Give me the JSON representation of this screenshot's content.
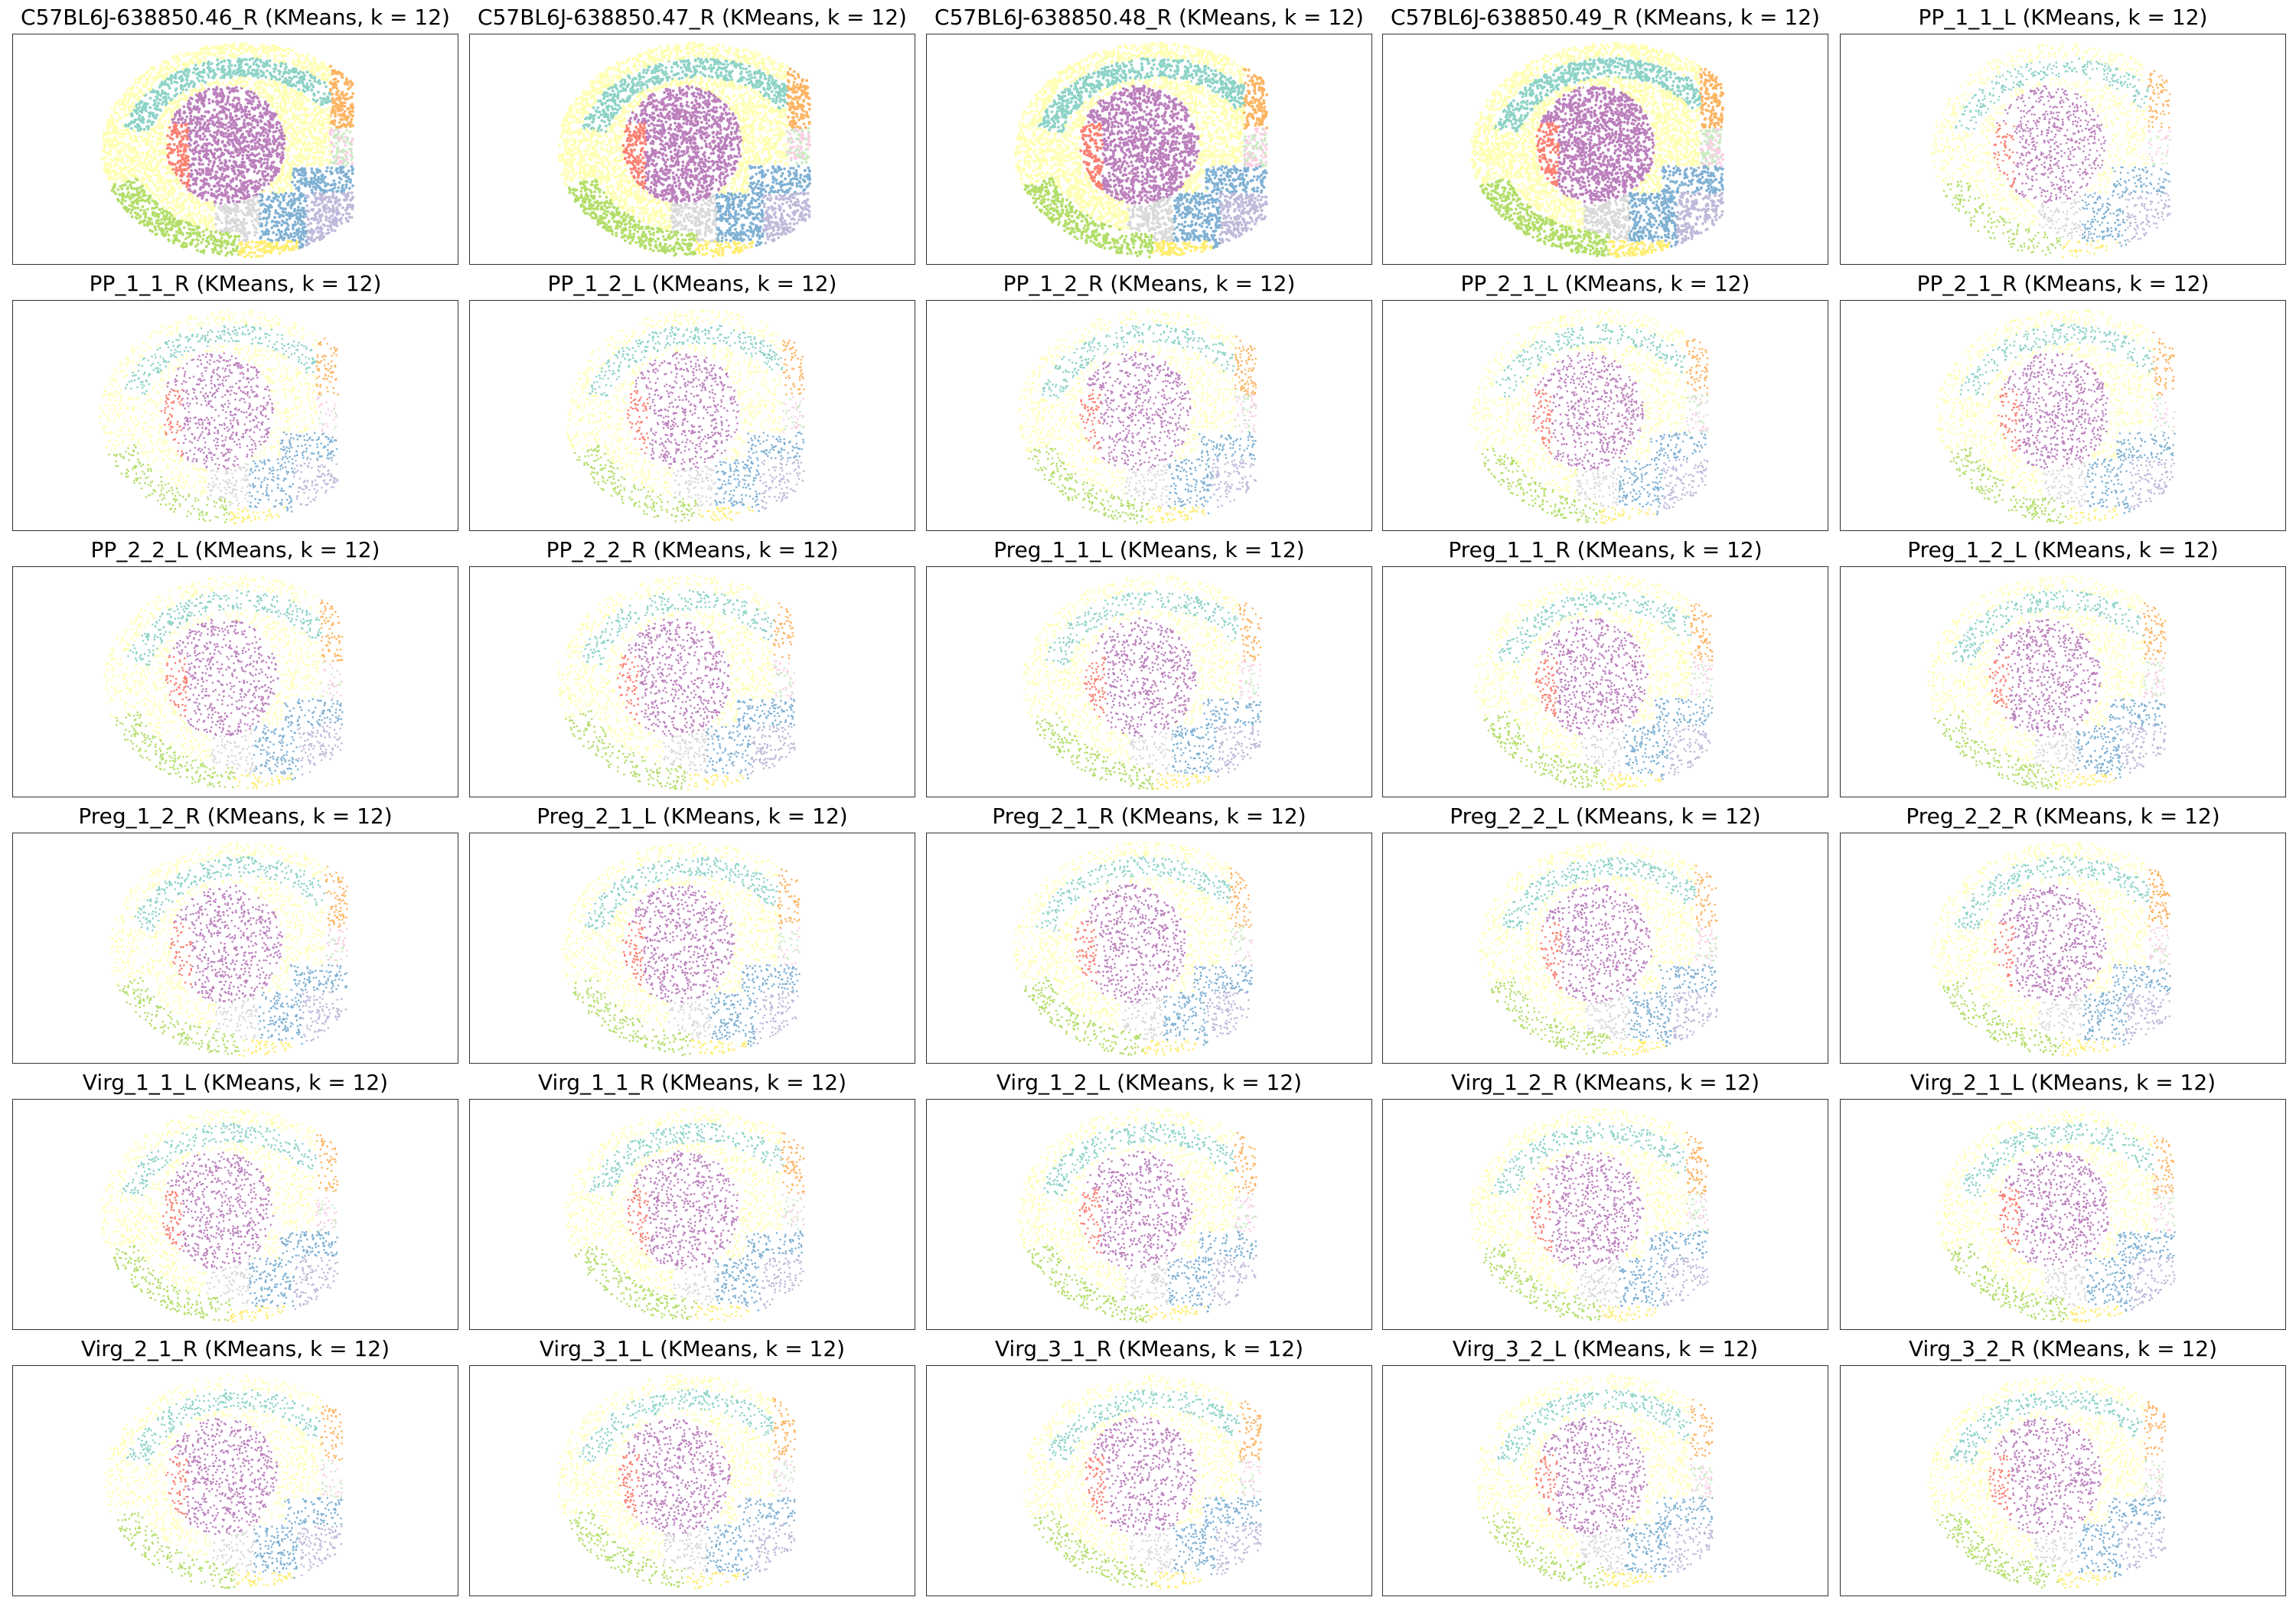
{
  "figure": {
    "layout": {
      "rows": 6,
      "cols": 5
    }
  },
  "chart_data": {
    "type": "scatter",
    "method": "KMeans",
    "k": 12,
    "axes_ticks": "none",
    "cluster_colors": [
      "#8dd3c7",
      "#ffffb3",
      "#bebada",
      "#fb8072",
      "#80b1d3",
      "#fdb462",
      "#b3de69",
      "#fccde5",
      "#d9d9d9",
      "#bc80bd",
      "#ccebc5",
      "#ffed6f"
    ],
    "panels": [
      {
        "title": "C57BL6J-638850.46_R (KMeans, k = 12)",
        "style": "dense"
      },
      {
        "title": "C57BL6J-638850.47_R (KMeans, k = 12)",
        "style": "dense"
      },
      {
        "title": "C57BL6J-638850.48_R (KMeans, k = 12)",
        "style": "dense"
      },
      {
        "title": "C57BL6J-638850.49_R (KMeans, k = 12)",
        "style": "dense"
      },
      {
        "title": "PP_1_1_L (KMeans, k = 12)",
        "style": "sparse"
      },
      {
        "title": "PP_1_1_R (KMeans, k = 12)",
        "style": "sparse"
      },
      {
        "title": "PP_1_2_L (KMeans, k = 12)",
        "style": "sparse"
      },
      {
        "title": "PP_1_2_R (KMeans, k = 12)",
        "style": "sparse"
      },
      {
        "title": "PP_2_1_L (KMeans, k = 12)",
        "style": "sparse"
      },
      {
        "title": "PP_2_1_R (KMeans, k = 12)",
        "style": "sparse"
      },
      {
        "title": "PP_2_2_L (KMeans, k = 12)",
        "style": "sparse"
      },
      {
        "title": "PP_2_2_R (KMeans, k = 12)",
        "style": "sparse"
      },
      {
        "title": "Preg_1_1_L (KMeans, k = 12)",
        "style": "sparse"
      },
      {
        "title": "Preg_1_1_R (KMeans, k = 12)",
        "style": "sparse"
      },
      {
        "title": "Preg_1_2_L (KMeans, k = 12)",
        "style": "sparse"
      },
      {
        "title": "Preg_1_2_R (KMeans, k = 12)",
        "style": "sparse"
      },
      {
        "title": "Preg_2_1_L (KMeans, k = 12)",
        "style": "sparse"
      },
      {
        "title": "Preg_2_1_R (KMeans, k = 12)",
        "style": "sparse"
      },
      {
        "title": "Preg_2_2_L (KMeans, k = 12)",
        "style": "sparse"
      },
      {
        "title": "Preg_2_2_R (KMeans, k = 12)",
        "style": "sparse"
      },
      {
        "title": "Virg_1_1_L (KMeans, k = 12)",
        "style": "sparse"
      },
      {
        "title": "Virg_1_1_R (KMeans, k = 12)",
        "style": "sparse"
      },
      {
        "title": "Virg_1_2_L (KMeans, k = 12)",
        "style": "sparse"
      },
      {
        "title": "Virg_1_2_R (KMeans, k = 12)",
        "style": "sparse"
      },
      {
        "title": "Virg_2_1_L (KMeans, k = 12)",
        "style": "sparse"
      },
      {
        "title": "Virg_2_1_R (KMeans, k = 12)",
        "style": "sparse"
      },
      {
        "title": "Virg_3_1_L (KMeans, k = 12)",
        "style": "sparse"
      },
      {
        "title": "Virg_3_1_R (KMeans, k = 12)",
        "style": "sparse"
      },
      {
        "title": "Virg_3_2_L (KMeans, k = 12)",
        "style": "sparse"
      },
      {
        "title": "Virg_3_2_R (KMeans, k = 12)",
        "style": "sparse"
      }
    ]
  }
}
